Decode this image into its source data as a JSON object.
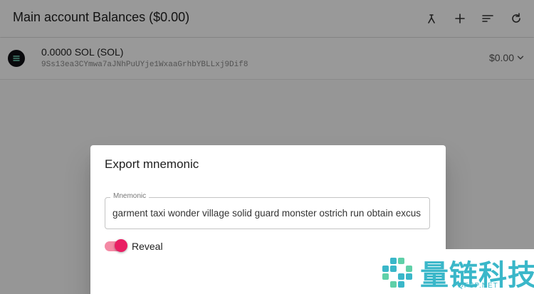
{
  "header": {
    "title": "Main account Balances ($0.00)",
    "icons": [
      "person-arrow-icon",
      "plus-icon",
      "sort-icon",
      "refresh-icon"
    ]
  },
  "account": {
    "icon": "menu-lines-icon",
    "title": "0.0000 SOL (SOL)",
    "address": "9Ss13ea3CYmwa7aJNhPuUYje1WxaaGrhbYBLLxj9Dif8",
    "amount": "$0.00",
    "chevron": "chevron-down-icon"
  },
  "dialog": {
    "title": "Export mnemonic",
    "field_label": "Mnemonic",
    "field_value": "garment taxi wonder village solid guard monster ostrich run obtain excus",
    "toggle_label": "Reveal",
    "toggle_on": true
  },
  "watermark": {
    "text": "量链科技",
    "sub": "QFSP.NET"
  },
  "colors": {
    "accent": "#e91e63",
    "accent_track": "#f48aa5",
    "watermark": "#3ab7c9"
  }
}
